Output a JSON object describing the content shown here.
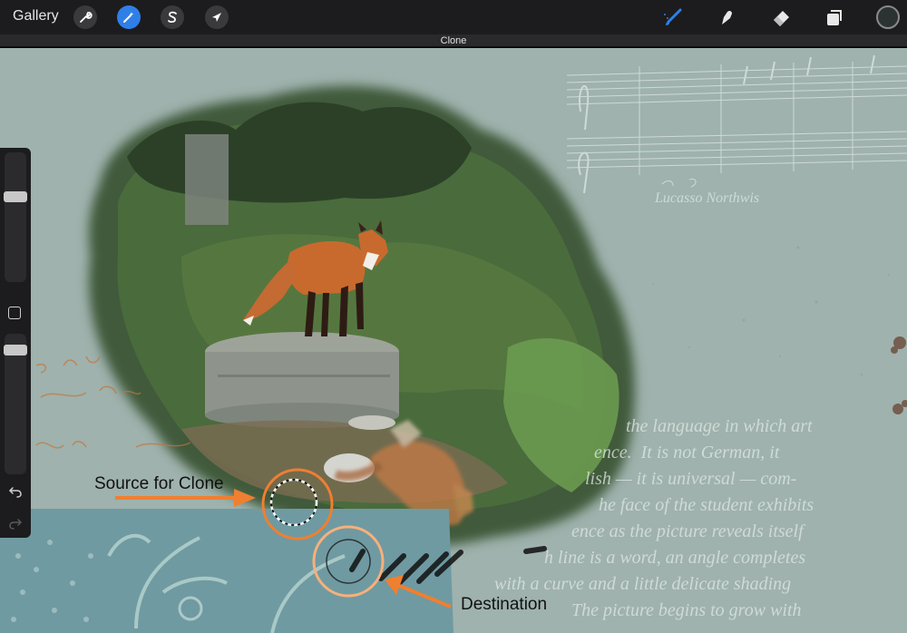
{
  "toolbar": {
    "gallery_label": "Gallery",
    "left_tools": [
      {
        "name": "actions",
        "icon": "wrench-icon"
      },
      {
        "name": "adjustments",
        "icon": "magic-wand-icon",
        "active": true
      },
      {
        "name": "selection",
        "icon": "selection-s-icon"
      },
      {
        "name": "transform",
        "icon": "arrow-cursor-icon"
      }
    ],
    "right_tools": [
      {
        "name": "paint",
        "icon": "brush-icon",
        "active": true
      },
      {
        "name": "smudge",
        "icon": "smudge-finger-icon"
      },
      {
        "name": "erase",
        "icon": "eraser-icon"
      },
      {
        "name": "layers",
        "icon": "layers-icon"
      },
      {
        "name": "color",
        "icon": "color-swatch",
        "color": "#2a3332"
      }
    ]
  },
  "mode_label": "Clone",
  "sidebar": {
    "size_slider_level": 0.33,
    "opacity_slider_level": 0.08,
    "icons": [
      "modify-square-icon",
      "undo-icon",
      "redo-icon"
    ]
  },
  "canvas": {
    "background_color": "#9fb2ad",
    "accent_orange": "#f07f2f",
    "light_orange": "#f7b07a",
    "overlay_text_lines": [
      "the language in which art",
      "ence.  It is not German, it",
      "lish — it is universal — com-",
      "he face of the student exhibits",
      "ence as the picture reveals itself",
      "h line is a word, an angle completes",
      "with a curve and a little delicate shading",
      "The picture begins to grow with"
    ],
    "music_text": "Lucasso Northwis"
  },
  "annotations": {
    "source_label": "Source for Clone",
    "destination_label": "Destination"
  }
}
